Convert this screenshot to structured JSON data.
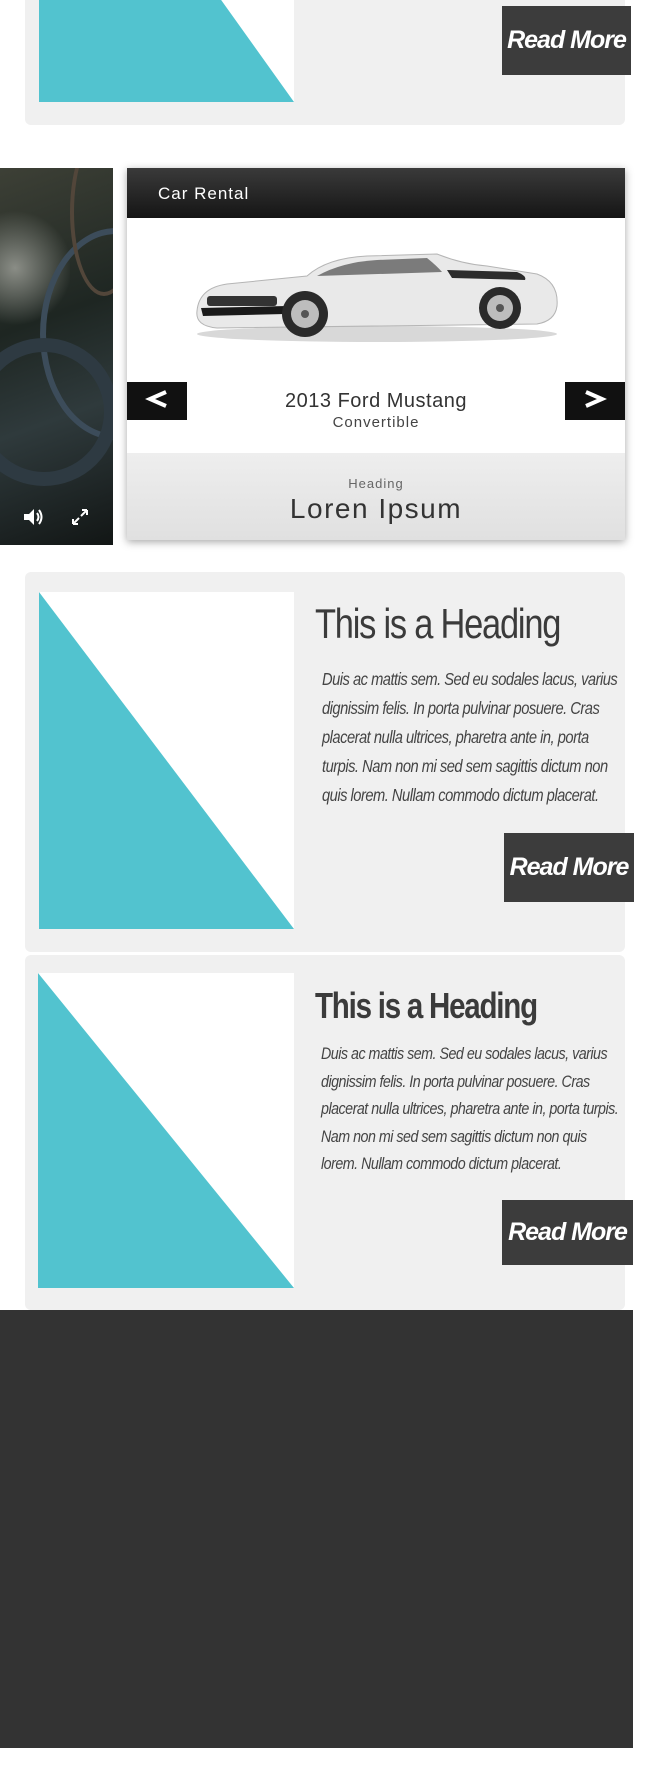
{
  "colors": {
    "accent": "#52c3cf",
    "button_bg": "#3c3c3c",
    "card_bg": "#f0f0f0",
    "footer_bg": "#333333"
  },
  "cards": [
    {
      "heading": "",
      "body": "",
      "button_label": "Read More"
    },
    {
      "heading": "This is a Heading",
      "body": "Duis ac mattis sem. Sed eu sodales lacus, varius dignissim felis. In porta pulvinar posuere. Cras placerat nulla ultrices, pharetra ante in, porta turpis. Nam non mi sed sem sagittis dictum non quis lorem. Nullam commodo dictum placerat.",
      "button_label": "Read More"
    },
    {
      "heading": "This is a Heading",
      "body": "Duis ac mattis sem. Sed eu sodales lacus, varius dignissim felis. In porta pulvinar posuere. Cras placerat nulla ultrices, pharetra ante in, porta turpis. Nam non mi sed sem sagittis dictum non quis lorem. Nullam commodo dictum placerat.",
      "button_label": "Read More"
    }
  ],
  "video": {
    "volume_icon": "volume-icon",
    "fullscreen_icon": "fullscreen-icon"
  },
  "rental": {
    "title": "Car Rental",
    "car_name": "2013 Ford Mustang",
    "car_type": "Convertible",
    "prev_icon": "chevron-left-icon",
    "next_icon": "chevron-right-icon",
    "footer_label": "Heading",
    "footer_title": "Loren Ipsum"
  }
}
